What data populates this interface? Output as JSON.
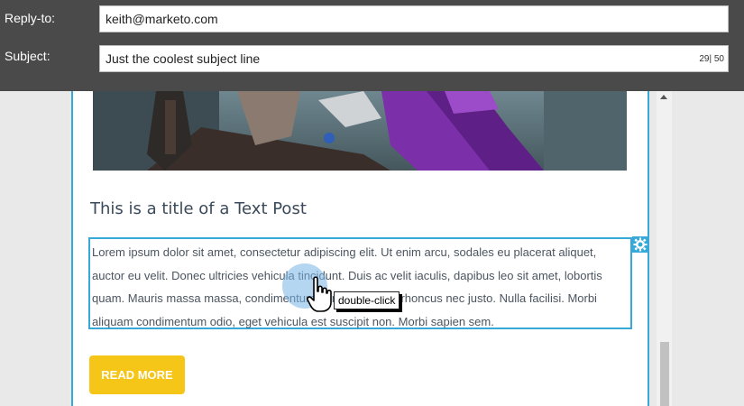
{
  "header": {
    "reply_to_label": "Reply-to:",
    "reply_to_value": "keith@marketo.com",
    "subject_label": "Subject:",
    "subject_value": "Just the coolest subject line",
    "subject_counter": "29| 50"
  },
  "email": {
    "post_title": "This is a title of a Text Post",
    "body_text": "Lorem ipsum dolor sit amet, consectetur adipiscing elit. Ut enim arcu, sodales eu placerat aliquet, auctor eu velit. Donec ultricies vehicula tincidunt. Duis ac velit iaculis, dapibus leo sit amet, lobortis quam. Mauris massa massa, condimentum at mollis nan a, rhoncus nec justo. Nulla facilisi. Morbi aliquam condimentum odio, eget vehicula est suscipit non. Morbi sapien sem.",
    "read_more_label": "READ MORE"
  },
  "tooltip": {
    "text": "double-click"
  },
  "colors": {
    "header_bg": "#4a4a4a",
    "selection_blue": "#36a9d8",
    "button_yellow": "#f5c518",
    "title_color": "#3b4a5a"
  },
  "icons": {
    "settings": "gear-icon",
    "cursor": "hand-pointer-icon",
    "scroll_up": "chevron-up-icon"
  }
}
